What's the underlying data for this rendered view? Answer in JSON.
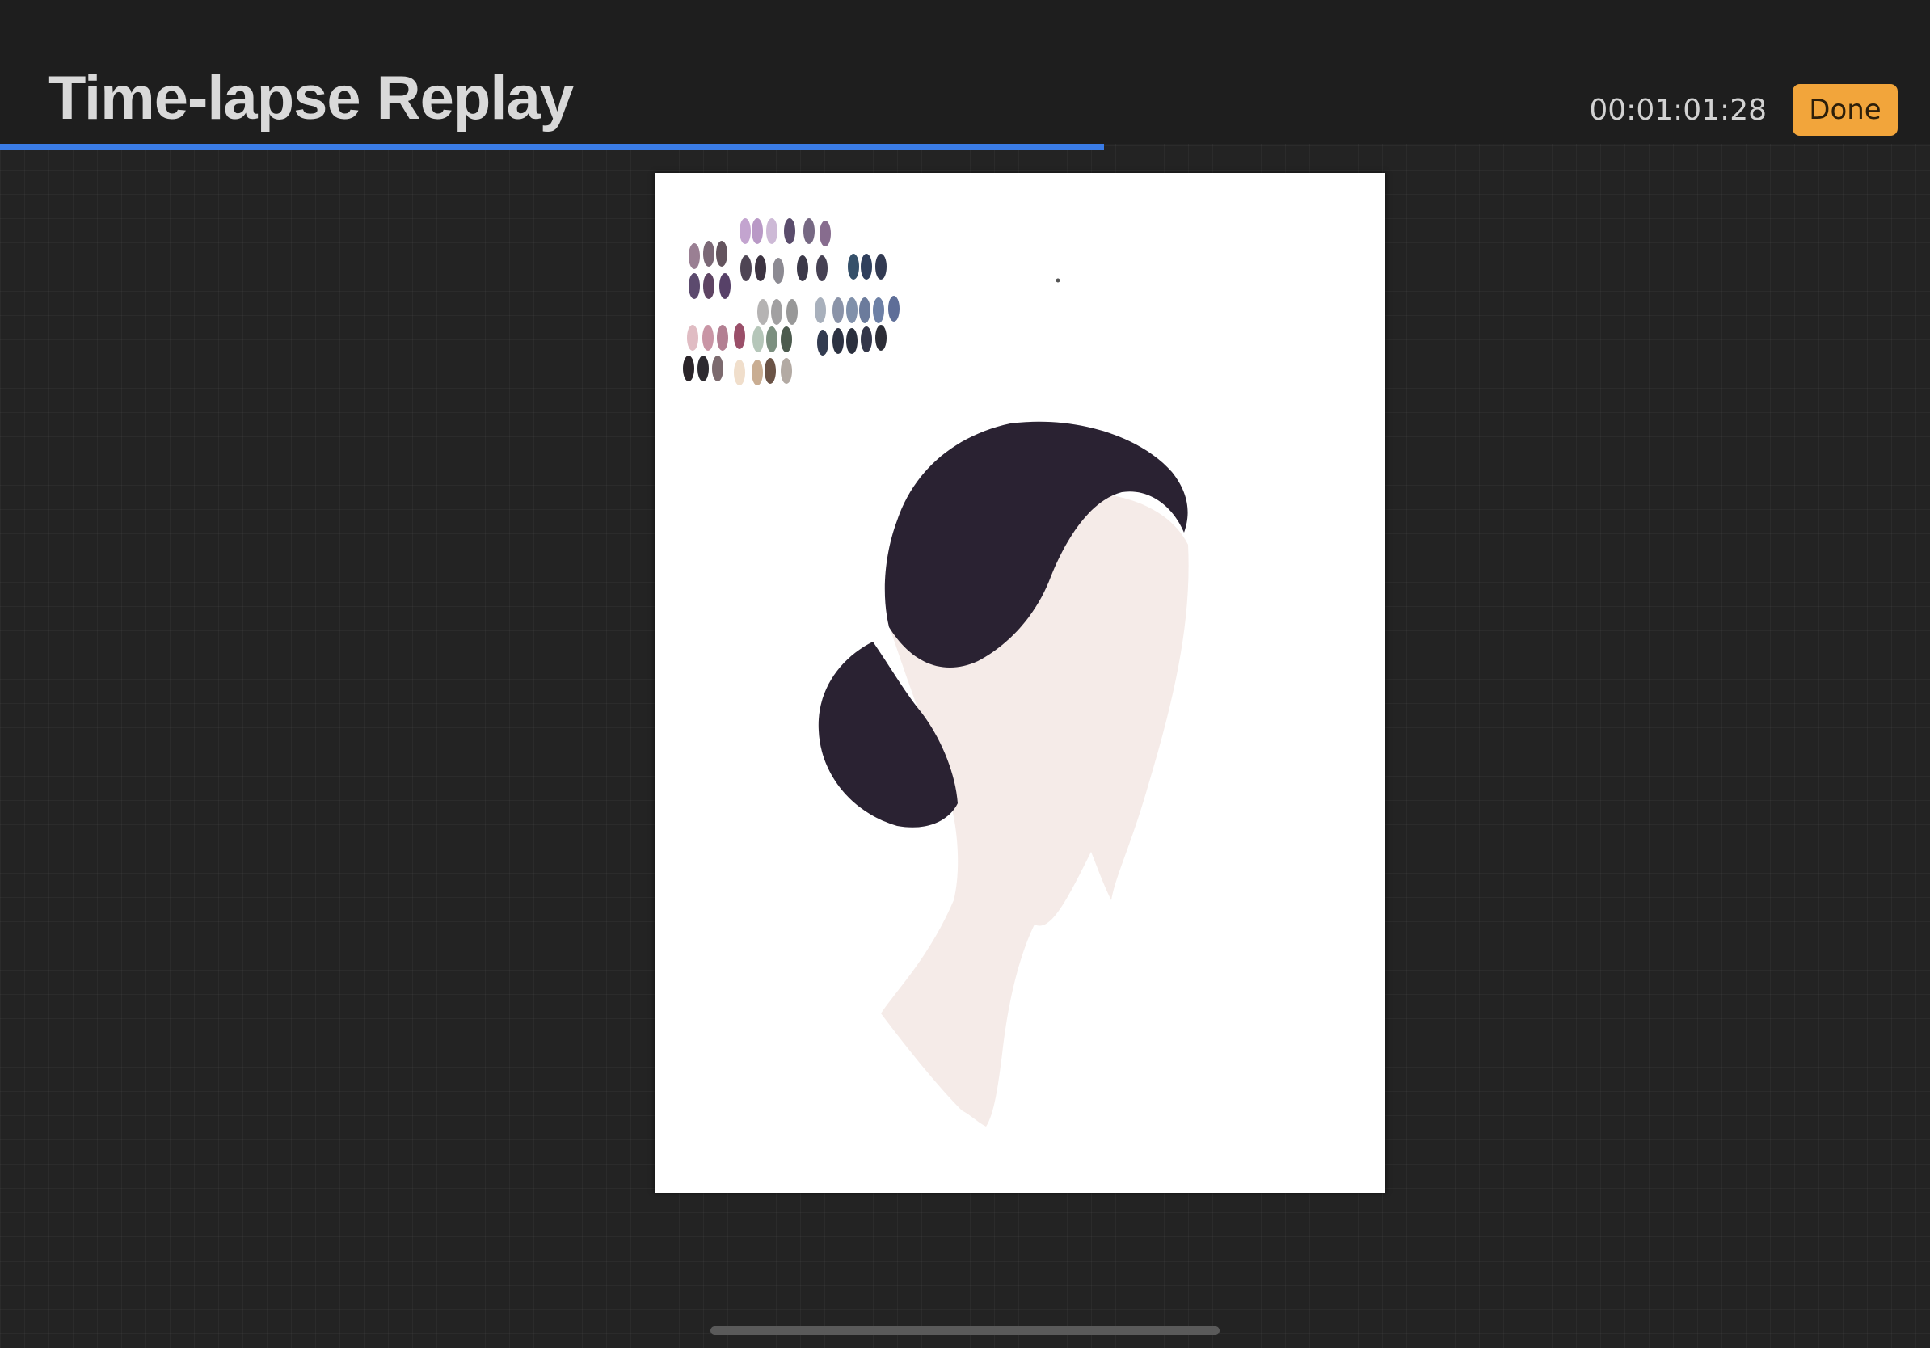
{
  "header": {
    "title": "Time-lapse Replay",
    "timecode": "00:01:01:28",
    "done_label": "Done"
  },
  "playback": {
    "progress_fraction": 0.572,
    "progress_color": "#3a7ce6"
  },
  "colors": {
    "accent": "#f2a53b",
    "hair": "#2a2232",
    "skin": "#f5ebe8",
    "canvas": "#ffffff"
  },
  "swatches": [
    "#9a7f93",
    "#7b6876",
    "#64545e",
    "#c3a4cf",
    "#b999c6",
    "#cdb9d6",
    "#5a4c6c",
    "#766883",
    "#876c8e",
    "#5c4a6e",
    "#5e4463",
    "#574168",
    "#4e4554",
    "#3d3442",
    "#8c8a92",
    "#3c3949",
    "#464153",
    "#35506a",
    "#2f3f5c",
    "#323a52",
    "#b5b3b3",
    "#a1a0a1",
    "#989898",
    "#a8b0bc",
    "#8a93a8",
    "#8090aa",
    "#6b7b9c",
    "#6d80a6",
    "#5e6e98",
    "#e0bcc3",
    "#c995a5",
    "#b37f92",
    "#9a4f69",
    "#b5c6b9",
    "#7b8f7f",
    "#4c5b4e",
    "#323b50",
    "#2c3242",
    "#2a2f3d",
    "#333649",
    "#2c2d36",
    "#2a2429",
    "#2d2a30",
    "#7c6a6e",
    "#f0decb",
    "#c9ad92",
    "#6b5346",
    "#b3aaa3"
  ]
}
